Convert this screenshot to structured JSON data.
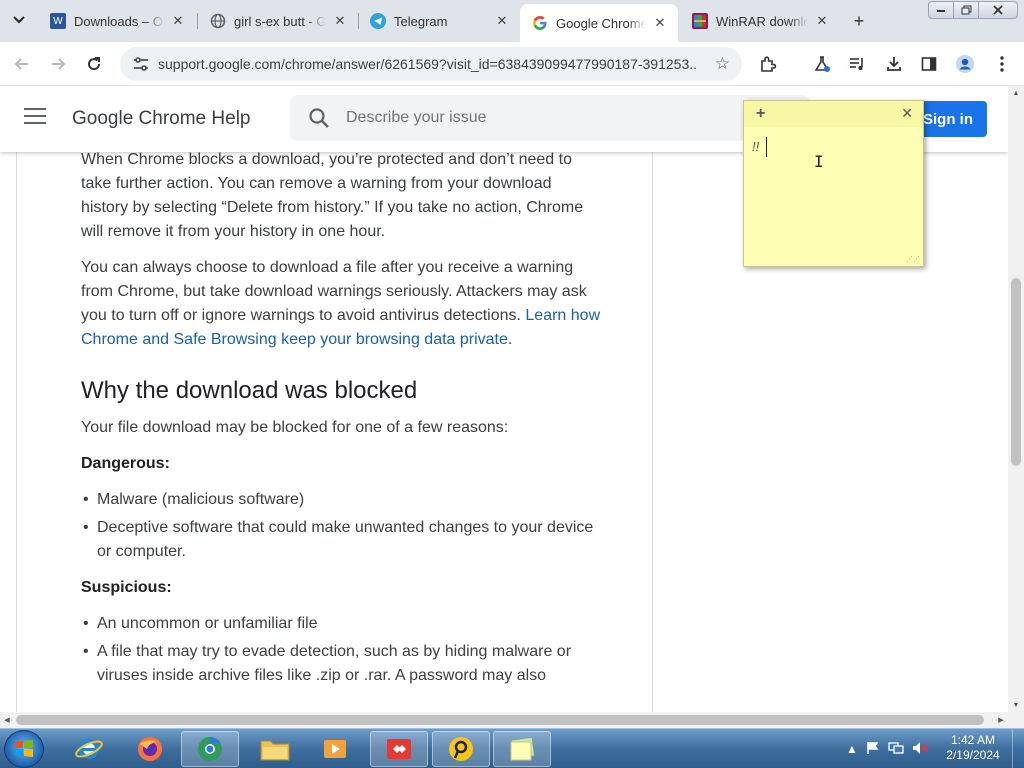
{
  "tabs": [
    {
      "title": "Downloads – Or",
      "favicon": "w-doc-icon",
      "color": "#2b579a"
    },
    {
      "title": "girl s-ex butt - G",
      "favicon": "globe-icon",
      "color": "#5f6368"
    },
    {
      "title": "Telegram",
      "favicon": "telegram-icon",
      "color": "#2aa3de"
    },
    {
      "title": "Google Chrome",
      "favicon": "google-icon",
      "color": "#4285f4"
    },
    {
      "title": "WinRAR downlo",
      "favicon": "winrar-icon",
      "color": "#8b1c55"
    }
  ],
  "active_tab": 3,
  "address_bar": {
    "url": "support.google.com/chrome/answer/6261569?visit_id=638439099477990187-391253..."
  },
  "help_header": {
    "title": "Google Chrome Help",
    "search_placeholder": "Describe your issue",
    "sign_in": "Sign in"
  },
  "article": {
    "p1": "When Chrome blocks a download, you’re protected and don’t need to take further action. You can remove a warning from your download history by selecting “Delete from history.” If you take no action, Chrome will remove it from your history in one hour.",
    "p2_text": "You can always choose to download a file after you receive a warning from Chrome, but take download warnings seriously. Attackers may ask you to turn off or ignore warnings to avoid antivirus detections.",
    "p2_link": "Learn how Chrome and Safe Browsing keep your browsing data private",
    "p2_end": ".",
    "heading": "Why the download was blocked",
    "intro": "Your file download may be blocked for one of a few reasons:",
    "dangerous_label": "Dangerous:",
    "dangerous_items": [
      "Malware (malicious software)",
      "Deceptive software that could make unwanted changes to your device or computer."
    ],
    "suspicious_label": "Suspicious:",
    "suspicious_items": [
      "An uncommon or unfamiliar file",
      "A file that may try to evade detection, such as by hiding malware or viruses inside archive files like .zip or .rar. A password may also"
    ]
  },
  "sticky_note": {
    "text": "!!"
  },
  "taskbar": {
    "time": "1:42 AM",
    "date": "2/19/2024"
  },
  "colors": {
    "accent": "#1a73e8",
    "link": "#1a5fb4",
    "sticky": "#fdfdb4"
  }
}
